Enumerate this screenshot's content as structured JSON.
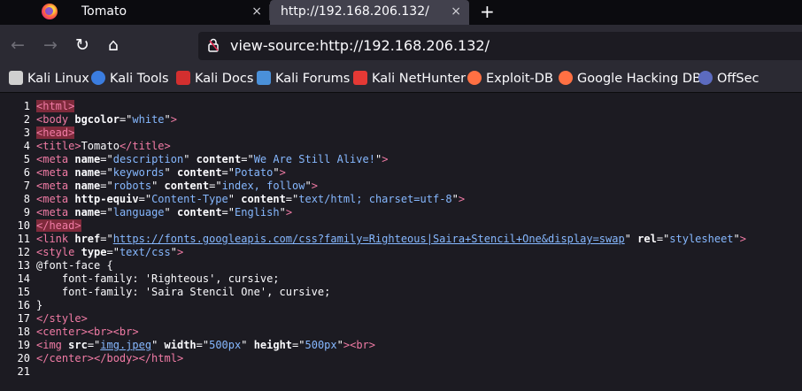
{
  "tabs": [
    {
      "label": "Tomato",
      "close": "×"
    },
    {
      "label": "http://192.168.206.132/",
      "close": "×"
    }
  ],
  "newtab": "+",
  "nav": {
    "back": "←",
    "forward": "→",
    "reload": "↻",
    "home": "⌂"
  },
  "url": "view-source:http://192.168.206.132/",
  "bookmarks": [
    {
      "label": "Kali Linux",
      "color": "#d0d0d0"
    },
    {
      "label": "Kali Tools",
      "color": "#3b7de0"
    },
    {
      "label": "Kali Docs",
      "color": "#d32f2f"
    },
    {
      "label": "Kali Forums",
      "color": "#4a90d9"
    },
    {
      "label": "Kali NetHunter",
      "color": "#e53935"
    },
    {
      "label": "Exploit-DB",
      "color": "#ff7043"
    },
    {
      "label": "Google Hacking DB",
      "color": "#ff7043"
    },
    {
      "label": "OffSec",
      "color": "#5c6bc0"
    }
  ],
  "source_lines": [
    {
      "n": "1",
      "html": "<span class=\"tag tag-hl\">&lt;html&gt;</span>"
    },
    {
      "n": "2",
      "html": "<span class=\"tag\">&lt;body</span> <span class=\"attr\">bgcolor</span>=\"<span class=\"val\">white</span>\"<span class=\"tag\">&gt;</span>"
    },
    {
      "n": "3",
      "html": "<span class=\"tag tag-hl\">&lt;head&gt;</span>"
    },
    {
      "n": "4",
      "html": "<span class=\"tag\">&lt;title&gt;</span>Tomato<span class=\"tag\">&lt;/title&gt;</span>"
    },
    {
      "n": "5",
      "html": "<span class=\"tag\">&lt;meta</span> <span class=\"attr\">name</span>=\"<span class=\"val\">description</span>\" <span class=\"attr\">content</span>=\"<span class=\"val\">We Are Still Alive!</span>\"<span class=\"tag\">&gt;</span>"
    },
    {
      "n": "6",
      "html": "<span class=\"tag\">&lt;meta</span> <span class=\"attr\">name</span>=\"<span class=\"val\">keywords</span>\" <span class=\"attr\">content</span>=\"<span class=\"val\">Potato</span>\"<span class=\"tag\">&gt;</span>"
    },
    {
      "n": "7",
      "html": "<span class=\"tag\">&lt;meta</span> <span class=\"attr\">name</span>=\"<span class=\"val\">robots</span>\" <span class=\"attr\">content</span>=\"<span class=\"val\">index, follow</span>\"<span class=\"tag\">&gt;</span>"
    },
    {
      "n": "8",
      "html": "<span class=\"tag\">&lt;meta</span> <span class=\"attr\">http-equiv</span>=\"<span class=\"val\">Content-Type</span>\" <span class=\"attr\">content</span>=\"<span class=\"val\">text/html; charset=utf-8</span>\"<span class=\"tag\">&gt;</span>"
    },
    {
      "n": "9",
      "html": "<span class=\"tag\">&lt;meta</span> <span class=\"attr\">name</span>=\"<span class=\"val\">language</span>\" <span class=\"attr\">content</span>=\"<span class=\"val\">English</span>\"<span class=\"tag\">&gt;</span>"
    },
    {
      "n": "10",
      "html": "<span class=\"tag tag-hl\">&lt;/head&gt;</span>"
    },
    {
      "n": "11",
      "html": "<span class=\"tag\">&lt;link</span> <span class=\"attr\">href</span>=\"<span class=\"link\">https://fonts.googleapis.com/css?family=Righteous|Saira+Stencil+One&amp;display=swap</span>\" <span class=\"attr\">rel</span>=\"<span class=\"val\">stylesheet</span>\"<span class=\"tag\">&gt;</span>"
    },
    {
      "n": "12",
      "html": "<span class=\"tag\">&lt;style</span> <span class=\"attr\">type</span>=\"<span class=\"val\">text/css</span>\"<span class=\"tag\">&gt;</span>"
    },
    {
      "n": "13",
      "html": "@font-face {"
    },
    {
      "n": "14",
      "html": "    font-family: 'Righteous', cursive;"
    },
    {
      "n": "15",
      "html": "    font-family: 'Saira Stencil One', cursive;"
    },
    {
      "n": "16",
      "html": "}"
    },
    {
      "n": "17",
      "html": "<span class=\"tag\">&lt;/style&gt;</span>"
    },
    {
      "n": "18",
      "html": "<span class=\"tag\">&lt;center&gt;</span><span class=\"tag\">&lt;br&gt;</span><span class=\"tag\">&lt;br&gt;</span>"
    },
    {
      "n": "19",
      "html": "<span class=\"tag\">&lt;img</span> <span class=\"attr\">src</span>=\"<span class=\"link\">img.jpeg</span>\" <span class=\"attr\">width</span>=\"<span class=\"val\">500px</span>\" <span class=\"attr\">height</span>=\"<span class=\"val\">500px</span>\"<span class=\"tag\">&gt;</span><span class=\"tag\">&lt;br&gt;</span>"
    },
    {
      "n": "20",
      "html": "<span class=\"tag\">&lt;/center&gt;</span><span class=\"tag\">&lt;/body&gt;</span><span class=\"tag\">&lt;/html&gt;</span>"
    },
    {
      "n": "21",
      "html": ""
    }
  ]
}
